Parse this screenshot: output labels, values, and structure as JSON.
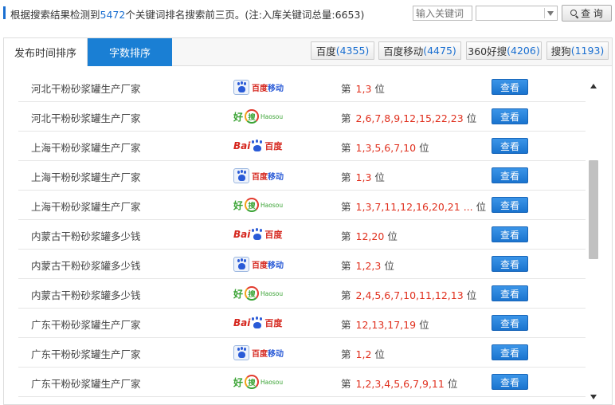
{
  "header": {
    "summary_prefix": "根据搜索结果检测到",
    "summary_count": "5472",
    "summary_suffix": "个关键词排名搜索前三页。(注:入库关键词总量:6653)",
    "search_placeholder": "输入关键词",
    "select_value": "",
    "query_label": "查 询"
  },
  "tabs": [
    {
      "label": "发布时间排序",
      "active": false
    },
    {
      "label": "字数排序",
      "active": true
    }
  ],
  "engines": [
    {
      "name": "百度",
      "count": "(4355)"
    },
    {
      "name": "百度移动",
      "count": "(4475)"
    },
    {
      "name": "360好搜",
      "count": "(4206)"
    },
    {
      "name": "搜狗",
      "count": "(1193)"
    }
  ],
  "rank_prefix": "第",
  "rank_suffix": "位",
  "view_label": "查看",
  "logos": {
    "baidu_mobile": {
      "t1": "百度",
      "t2": "移动",
      "icon": "baidu-paw-icon"
    },
    "haosou": {
      "hao": "好",
      "sou": "搜",
      "eng": "Haosou",
      "icon": "haosou-ring-icon"
    },
    "baidu": {
      "bai": "Bai",
      "du": "百度",
      "icon": "baidu-paw-icon"
    }
  },
  "rows": [
    {
      "keyword": "河北干粉砂浆罐生产厂家",
      "engine": "baidu_mobile",
      "positions": "1,3"
    },
    {
      "keyword": "河北干粉砂浆罐生产厂家",
      "engine": "haosou",
      "positions": "2,6,7,8,9,12,15,22,23"
    },
    {
      "keyword": "上海干粉砂浆罐生产厂家",
      "engine": "baidu",
      "positions": "1,3,5,6,7,10"
    },
    {
      "keyword": "上海干粉砂浆罐生产厂家",
      "engine": "baidu_mobile",
      "positions": "1,3"
    },
    {
      "keyword": "上海干粉砂浆罐生产厂家",
      "engine": "haosou",
      "positions": "1,3,7,11,12,16,20,21 ..."
    },
    {
      "keyword": "内蒙古干粉砂浆罐多少钱",
      "engine": "baidu",
      "positions": "12,20"
    },
    {
      "keyword": "内蒙古干粉砂浆罐多少钱",
      "engine": "baidu_mobile",
      "positions": "1,2,3"
    },
    {
      "keyword": "内蒙古干粉砂浆罐多少钱",
      "engine": "haosou",
      "positions": "2,4,5,6,7,10,11,12,13"
    },
    {
      "keyword": "广东干粉砂浆罐生产厂家",
      "engine": "baidu",
      "positions": "12,13,17,19"
    },
    {
      "keyword": "广东干粉砂浆罐生产厂家",
      "engine": "baidu_mobile",
      "positions": "1,2"
    },
    {
      "keyword": "广东干粉砂浆罐生产厂家",
      "engine": "haosou",
      "positions": "1,2,3,4,5,6,7,9,11"
    }
  ],
  "colors": {
    "accent": "#1a7fd4",
    "rank": "#e0301e"
  }
}
